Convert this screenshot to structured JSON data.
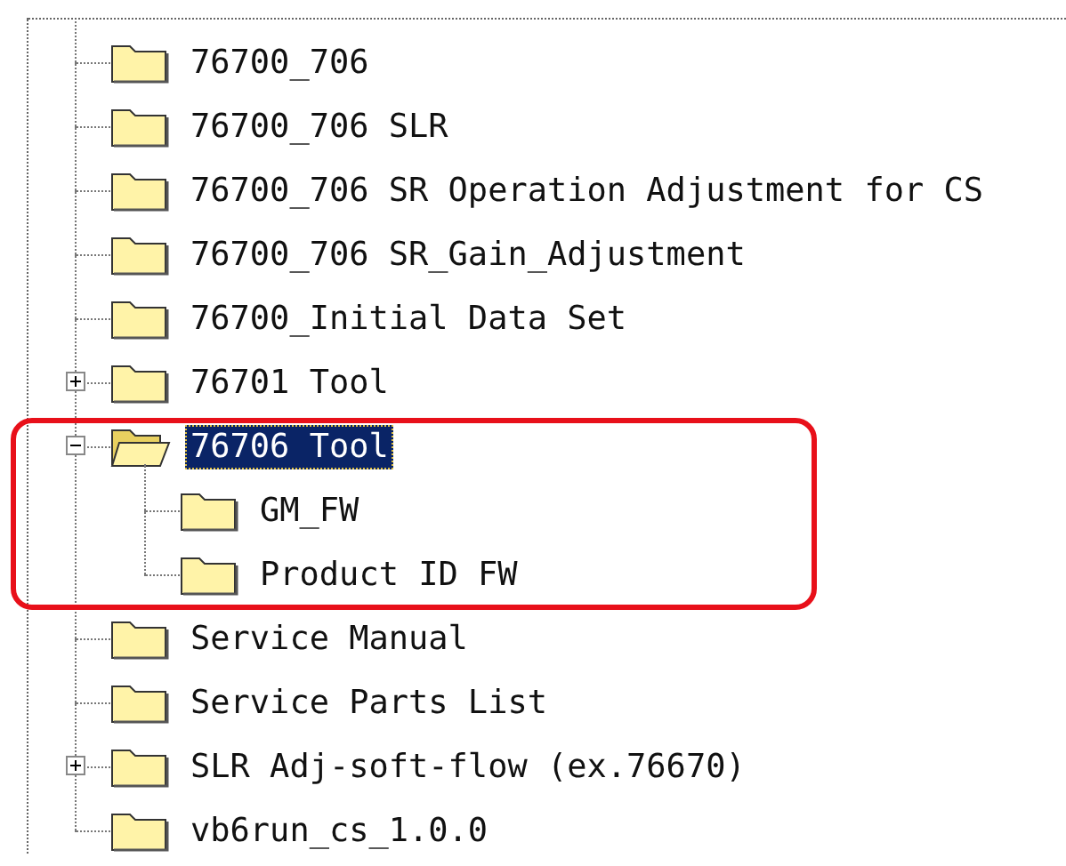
{
  "tree": {
    "items": [
      {
        "label": "76700_706",
        "selected": false
      },
      {
        "label": "76700_706 SLR",
        "selected": false
      },
      {
        "label": "76700_706 SR Operation Adjustment for CS",
        "selected": false
      },
      {
        "label": "76700_706 SR_Gain_Adjustment",
        "selected": false
      },
      {
        "label": "76700_Initial Data Set",
        "selected": false
      },
      {
        "label": "76701 Tool",
        "selected": false,
        "expanded": false
      },
      {
        "label": "76706 Tool",
        "selected": true,
        "expanded": true,
        "highlighted": true,
        "children": [
          {
            "label": "GM_FW",
            "selected": false
          },
          {
            "label": "Product ID FW",
            "selected": false
          }
        ]
      },
      {
        "label": "Service Manual",
        "selected": false
      },
      {
        "label": "Service Parts List",
        "selected": false
      },
      {
        "label": "SLR Adj-soft-flow (ex.76670)",
        "selected": false,
        "expanded": false
      },
      {
        "label": "vb6run_cs_1.0.0",
        "selected": false
      }
    ]
  }
}
